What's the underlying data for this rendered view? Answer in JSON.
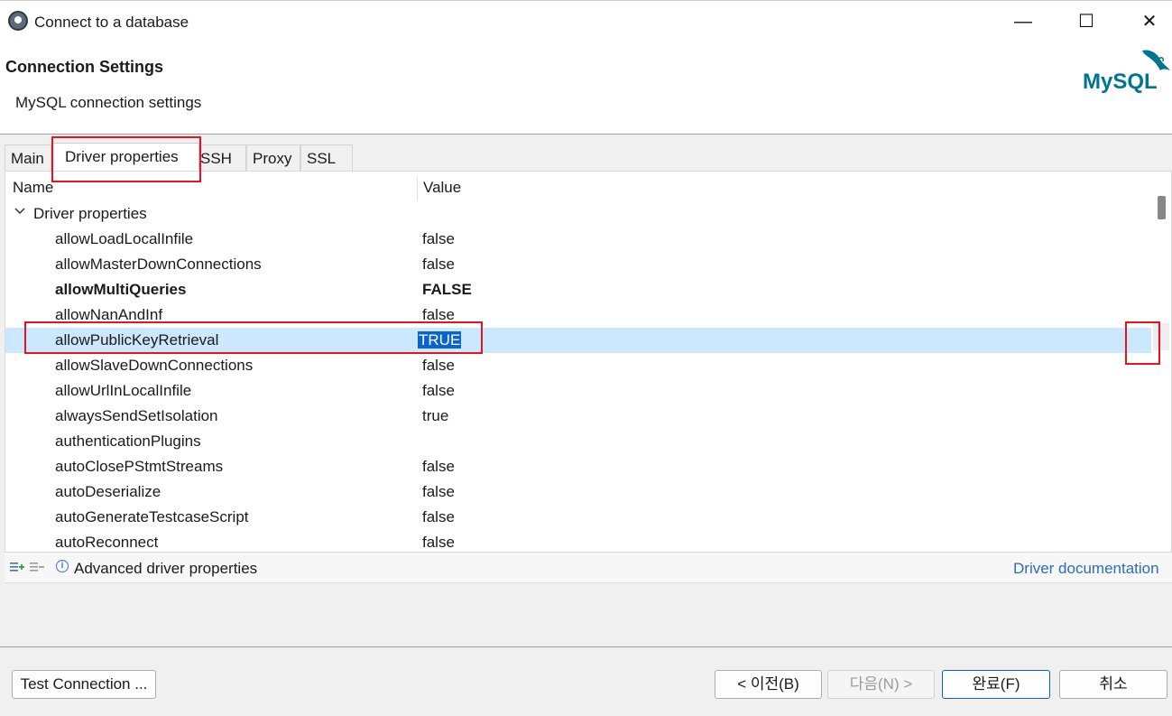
{
  "window": {
    "title": "Connect to a database",
    "minimize": "—",
    "maximize": "☐",
    "close": "✕"
  },
  "header": {
    "title": "Connection Settings",
    "subtitle": "MySQL connection settings",
    "logo_text": "MySQL"
  },
  "tabs": [
    {
      "label": "Main"
    },
    {
      "label": "Driver properties"
    },
    {
      "label": "SSH"
    },
    {
      "label": "Proxy"
    },
    {
      "label": "SSL"
    }
  ],
  "table": {
    "columns": [
      "Name",
      "Value"
    ],
    "group_label": "Driver properties",
    "rows": [
      {
        "name": "allowLoadLocalInfile",
        "value": "false"
      },
      {
        "name": "allowMasterDownConnections",
        "value": "false"
      },
      {
        "name": "allowMultiQueries",
        "value": "FALSE"
      },
      {
        "name": "allowNanAndInf",
        "value": "false"
      },
      {
        "name": "allowPublicKeyRetrieval",
        "value": "TRUE"
      },
      {
        "name": "allowSlaveDownConnections",
        "value": "false"
      },
      {
        "name": "allowUrlInLocalInfile",
        "value": "false"
      },
      {
        "name": "alwaysSendSetIsolation",
        "value": "true"
      },
      {
        "name": "authenticationPlugins",
        "value": ""
      },
      {
        "name": "autoClosePStmtStreams",
        "value": "false"
      },
      {
        "name": "autoDeserialize",
        "value": "false"
      },
      {
        "name": "autoGenerateTestcaseScript",
        "value": "false"
      },
      {
        "name": "autoReconnect",
        "value": "false"
      }
    ]
  },
  "footer": {
    "advanced_label": "Advanced driver properties",
    "doc_link": "Driver documentation",
    "info_glyph": "i"
  },
  "buttons": {
    "test_connection": "Test Connection ...",
    "back": "< 이전(B)",
    "next": "다음(N) >",
    "finish": "완료(F)",
    "cancel": "취소"
  },
  "colors": {
    "highlight_red": "#e8141b",
    "selected_row": "#cce8ff",
    "selected_value": "#0a64cc",
    "link": "#2a6ebb",
    "mysql_blue": "#00758f",
    "mysql_orange": "#f29111"
  }
}
